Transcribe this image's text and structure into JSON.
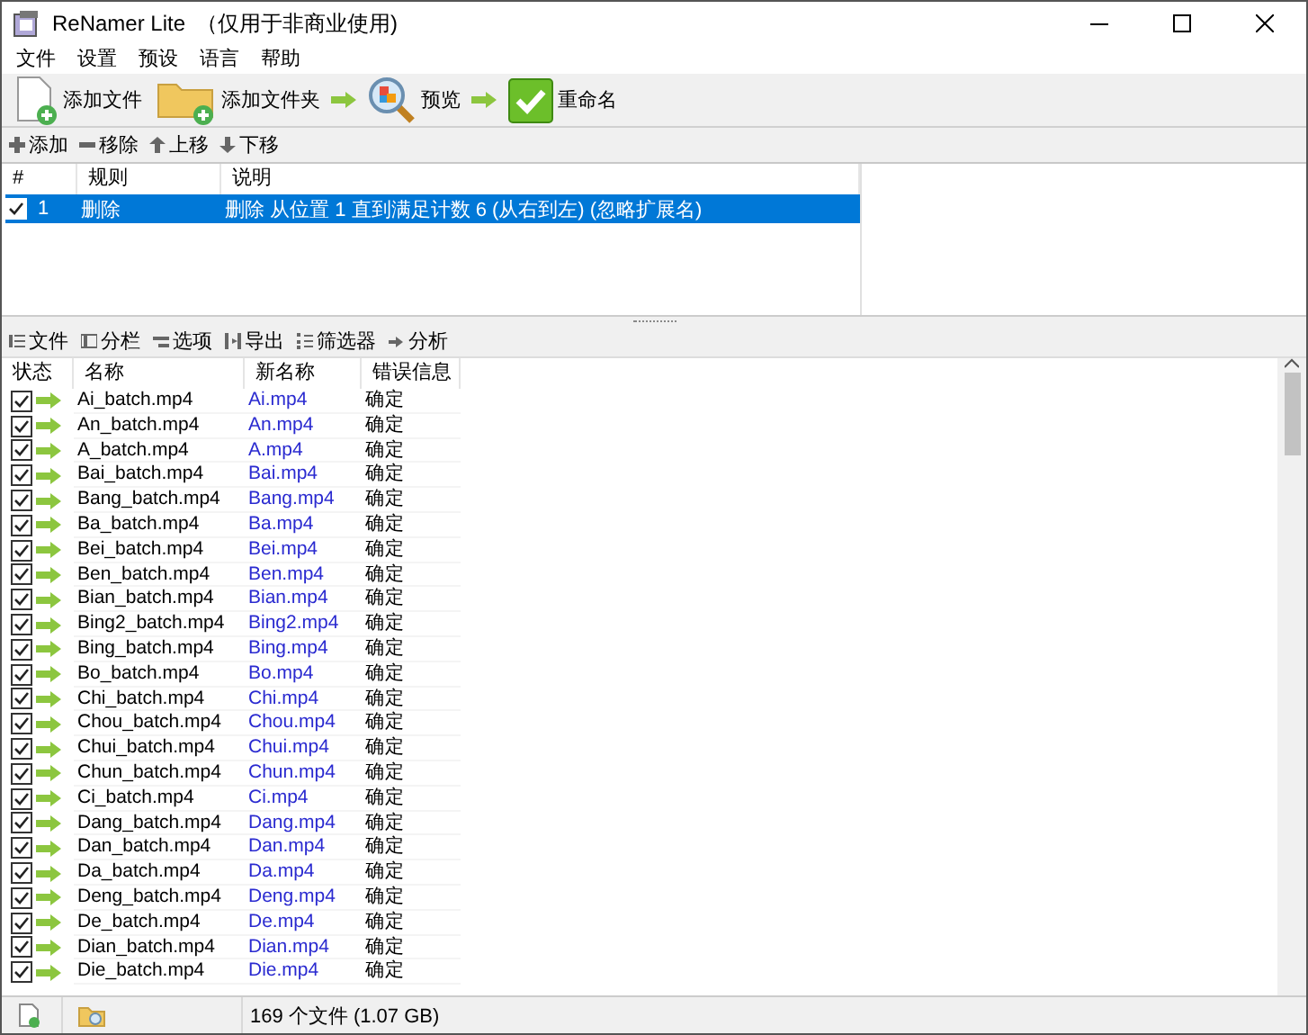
{
  "window": {
    "title": "ReNamer Lite",
    "subtitle": "（仅用于非商业使用)"
  },
  "menu": [
    "文件",
    "设置",
    "预设",
    "语言",
    "帮助"
  ],
  "toolbar": [
    {
      "label": "添加文件",
      "kind": "file"
    },
    {
      "label": "添加文件夹",
      "kind": "folder"
    },
    {
      "label": "预览",
      "kind": "preview"
    },
    {
      "label": "重命名",
      "kind": "rename"
    }
  ],
  "rule_toolbar": [
    {
      "label": "添加",
      "kind": "add"
    },
    {
      "label": "移除",
      "kind": "remove"
    },
    {
      "label": "上移",
      "kind": "up"
    },
    {
      "label": "下移",
      "kind": "down"
    }
  ],
  "rules": {
    "columns": [
      "#",
      "规则",
      "说明"
    ],
    "rows": [
      {
        "checked": true,
        "selected": true,
        "index": "1",
        "rule": "删除",
        "description": "删除 从位置 1 直到满足计数 6 (从右到左) (忽略扩展名)"
      }
    ]
  },
  "file_toolbar": [
    {
      "label": "文件",
      "kind": "files"
    },
    {
      "label": "分栏",
      "kind": "columns"
    },
    {
      "label": "选项",
      "kind": "options"
    },
    {
      "label": "导出",
      "kind": "export"
    },
    {
      "label": "筛选器",
      "kind": "filter"
    },
    {
      "label": "分析",
      "kind": "analyze"
    }
  ],
  "files": {
    "columns": [
      "状态",
      "名称",
      "新名称",
      "错误信息"
    ],
    "rows": [
      {
        "checked": true,
        "name": "Ai_batch.mp4",
        "new_name": "Ai.mp4",
        "error": "确定"
      },
      {
        "checked": true,
        "name": "An_batch.mp4",
        "new_name": "An.mp4",
        "error": "确定"
      },
      {
        "checked": true,
        "name": "A_batch.mp4",
        "new_name": "A.mp4",
        "error": "确定"
      },
      {
        "checked": true,
        "name": "Bai_batch.mp4",
        "new_name": "Bai.mp4",
        "error": "确定"
      },
      {
        "checked": true,
        "name": "Bang_batch.mp4",
        "new_name": "Bang.mp4",
        "error": "确定"
      },
      {
        "checked": true,
        "name": "Ba_batch.mp4",
        "new_name": "Ba.mp4",
        "error": "确定"
      },
      {
        "checked": true,
        "name": "Bei_batch.mp4",
        "new_name": "Bei.mp4",
        "error": "确定"
      },
      {
        "checked": true,
        "name": "Ben_batch.mp4",
        "new_name": "Ben.mp4",
        "error": "确定"
      },
      {
        "checked": true,
        "name": "Bian_batch.mp4",
        "new_name": "Bian.mp4",
        "error": "确定"
      },
      {
        "checked": true,
        "name": "Bing2_batch.mp4",
        "new_name": "Bing2.mp4",
        "error": "确定"
      },
      {
        "checked": true,
        "name": "Bing_batch.mp4",
        "new_name": "Bing.mp4",
        "error": "确定"
      },
      {
        "checked": true,
        "name": "Bo_batch.mp4",
        "new_name": "Bo.mp4",
        "error": "确定"
      },
      {
        "checked": true,
        "name": "Chi_batch.mp4",
        "new_name": "Chi.mp4",
        "error": "确定"
      },
      {
        "checked": true,
        "name": "Chou_batch.mp4",
        "new_name": "Chou.mp4",
        "error": "确定"
      },
      {
        "checked": true,
        "name": "Chui_batch.mp4",
        "new_name": "Chui.mp4",
        "error": "确定"
      },
      {
        "checked": true,
        "name": "Chun_batch.mp4",
        "new_name": "Chun.mp4",
        "error": "确定"
      },
      {
        "checked": true,
        "name": "Ci_batch.mp4",
        "new_name": "Ci.mp4",
        "error": "确定"
      },
      {
        "checked": true,
        "name": "Dang_batch.mp4",
        "new_name": "Dang.mp4",
        "error": "确定"
      },
      {
        "checked": true,
        "name": "Dan_batch.mp4",
        "new_name": "Dan.mp4",
        "error": "确定"
      },
      {
        "checked": true,
        "name": "Da_batch.mp4",
        "new_name": "Da.mp4",
        "error": "确定"
      },
      {
        "checked": true,
        "name": "Deng_batch.mp4",
        "new_name": "Deng.mp4",
        "error": "确定"
      },
      {
        "checked": true,
        "name": "De_batch.mp4",
        "new_name": "De.mp4",
        "error": "确定"
      },
      {
        "checked": true,
        "name": "Dian_batch.mp4",
        "new_name": "Dian.mp4",
        "error": "确定"
      },
      {
        "checked": true,
        "name": "Die_batch.mp4",
        "new_name": "Die.mp4",
        "error": "确定"
      }
    ]
  },
  "status_bar": "169 个文件 (1.07 GB)"
}
